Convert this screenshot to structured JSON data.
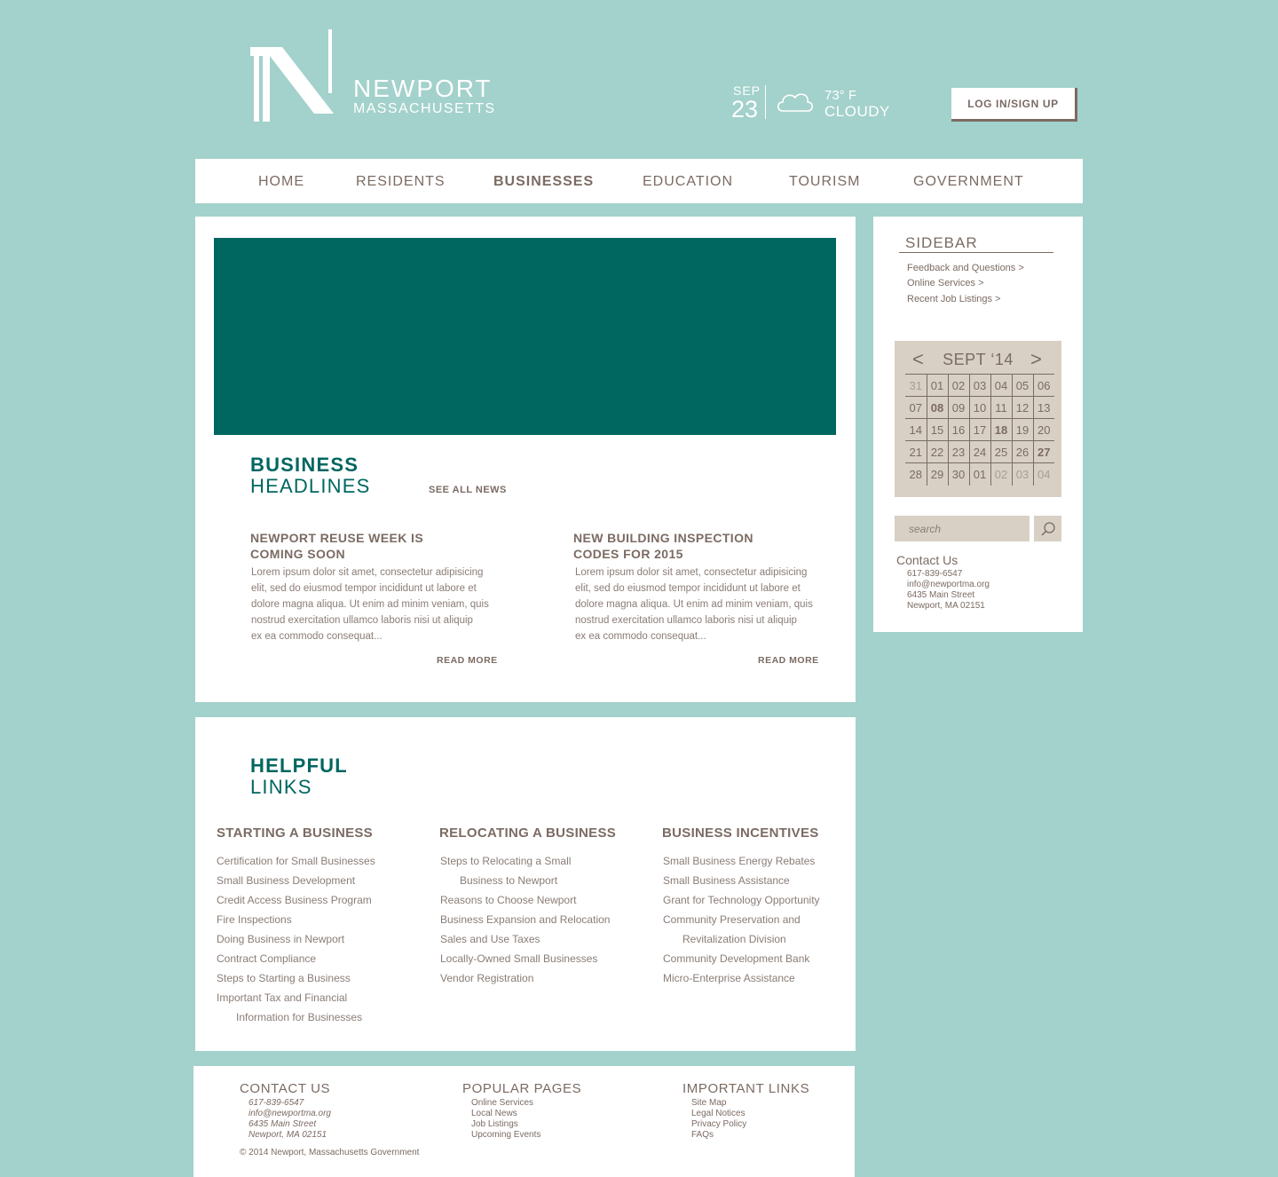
{
  "header": {
    "logo_title": "NEWPORT",
    "logo_subtitle": "MASSACHUSETTS",
    "weather": {
      "month": "SEP",
      "day": "23",
      "temp": "73° F",
      "condition": "CLOUDY"
    },
    "login_label": "LOG IN/SIGN UP"
  },
  "nav": [
    "HOME",
    "RESIDENTS",
    "BUSINESSES",
    "EDUCATION",
    "TOURISM",
    "GOVERNMENT"
  ],
  "nav_active": "BUSINESSES",
  "colors": {
    "background": "#a3d1cb",
    "accent": "#006660",
    "text": "#7b6b63",
    "calendar": "#d8d0c5"
  },
  "headlines": {
    "title_bold": "BUSINESS",
    "title_light": "HEADLINES",
    "see_all": "SEE ALL NEWS",
    "articles": [
      {
        "title_1": "NEWPORT REUSE WEEK IS",
        "title_2": "COMING SOON",
        "body": [
          "Lorem ipsum dolor sit amet, consectetur adipisicing",
          "elit, sed do eiusmod tempor incididunt ut labore et",
          "dolore magna aliqua. Ut enim ad minim veniam, quis",
          "nostrud exercitation ullamco laboris nisi ut aliquip",
          "ex ea commodo consequat..."
        ],
        "read_more": "READ MORE"
      },
      {
        "title_1": "NEW BUILDING INSPECTION",
        "title_2": "CODES FOR 2015",
        "body": [
          "Lorem ipsum dolor sit amet, consectetur adipisicing",
          "elit, sed do eiusmod tempor incididunt ut labore et",
          "dolore magna aliqua. Ut enim ad minim veniam, quis",
          "nostrud exercitation ullamco laboris nisi ut aliquip",
          "ex ea commodo consequat..."
        ],
        "read_more": "READ MORE"
      }
    ]
  },
  "sidebar": {
    "title": "SIDEBAR",
    "links": [
      "Feedback and Questions >",
      "Online Services >",
      "Recent Job Listings >"
    ],
    "calendar": {
      "prev": "<",
      "next": ">",
      "title": "SEPT ‘14",
      "rows": [
        [
          {
            "d": "31",
            "m": true
          },
          {
            "d": "01"
          },
          {
            "d": "02"
          },
          {
            "d": "03"
          },
          {
            "d": "04"
          },
          {
            "d": "05"
          },
          {
            "d": "06"
          }
        ],
        [
          {
            "d": "07"
          },
          {
            "d": "08",
            "b": true
          },
          {
            "d": "09"
          },
          {
            "d": "10"
          },
          {
            "d": "11"
          },
          {
            "d": "12"
          },
          {
            "d": "13"
          }
        ],
        [
          {
            "d": "14"
          },
          {
            "d": "15"
          },
          {
            "d": "16"
          },
          {
            "d": "17"
          },
          {
            "d": "18",
            "b": true
          },
          {
            "d": "19"
          },
          {
            "d": "20"
          }
        ],
        [
          {
            "d": "21"
          },
          {
            "d": "22"
          },
          {
            "d": "23"
          },
          {
            "d": "24"
          },
          {
            "d": "25"
          },
          {
            "d": "26"
          },
          {
            "d": "27",
            "b": true
          }
        ],
        [
          {
            "d": "28"
          },
          {
            "d": "29"
          },
          {
            "d": "30"
          },
          {
            "d": "01"
          },
          {
            "d": "02",
            "m": true
          },
          {
            "d": "03",
            "m": true
          },
          {
            "d": "04",
            "m": true
          }
        ]
      ]
    },
    "search_placeholder": "search",
    "contact": {
      "title": "Contact Us",
      "lines": [
        "617-839-6547",
        "info@newportma.org",
        "6435 Main Street",
        "Newport, MA 02151"
      ]
    }
  },
  "helpful_links": {
    "title_bold": "HELPFUL",
    "title_light": "LINKS",
    "columns": [
      {
        "title": "STARTING A BUSINESS",
        "items": [
          "Certification for Small Businesses",
          "Small Business Development",
          "Credit Access Business Program",
          "Fire Inspections",
          "Doing Business in Newport",
          "Contract Compliance",
          "Steps to Starting a Business",
          "Important Tax and Financial",
          "Information for Businesses"
        ]
      },
      {
        "title": "RELOCATING A BUSINESS",
        "items": [
          "Steps to Relocating a Small",
          "Business to Newport",
          "Reasons to Choose Newport",
          "Business Expansion and Relocation",
          "Sales and Use Taxes",
          "Locally-Owned Small Businesses",
          "Vendor Registration"
        ]
      },
      {
        "title": "BUSINESS INCENTIVES",
        "items": [
          "Small Business Energy Rebates",
          "Small Business Assistance",
          "Grant for Technology Opportunity",
          "Community Preservation and",
          "Revitalization Division",
          "Community Development Bank",
          "Micro-Enterprise Assistance"
        ]
      }
    ]
  },
  "footer": {
    "contact_title": "CONTACT US",
    "contact_lines": [
      "617-839-6547",
      "info@newportma.org",
      "6435 Main Street",
      "Newport, MA 02151"
    ],
    "popular_title": "POPULAR PAGES",
    "popular_links": [
      "Online Services",
      "Local News",
      "Job Listings",
      "Upcoming Events"
    ],
    "important_title": "IMPORTANT LINKS",
    "important_links": [
      "Site Map",
      "Legal Notices",
      "Privacy Policy",
      "FAQs"
    ],
    "copyright": "© 2014 Newport, Massachusetts Government"
  }
}
